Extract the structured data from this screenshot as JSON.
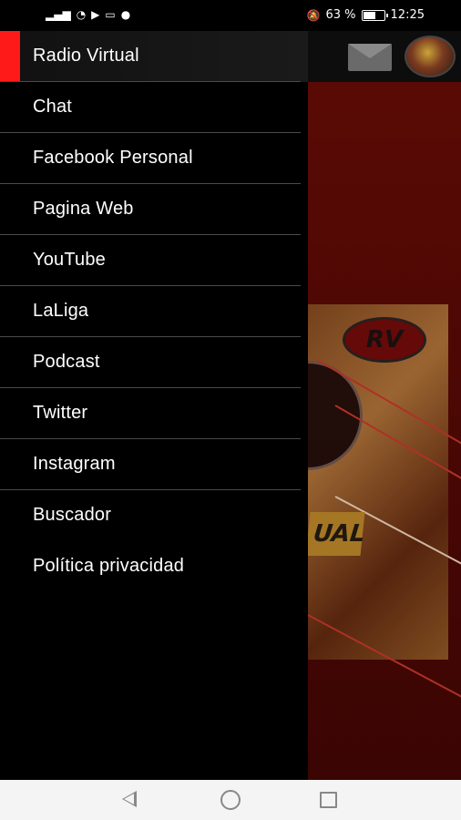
{
  "status_bar": {
    "battery_percent": "63 %",
    "time": "12:25",
    "left_icons": [
      "signal-icon",
      "wifi-icon",
      "play-icon",
      "cast-icon",
      "facebook-icon"
    ],
    "right_icons": [
      "mute-icon",
      "battery-icon"
    ],
    "battery_level": 0.63
  },
  "drawer": {
    "items": [
      {
        "label": "Radio Virtual",
        "active": true
      },
      {
        "label": "Chat"
      },
      {
        "label": "Facebook Personal"
      },
      {
        "label": "Pagina Web"
      },
      {
        "label": "YouTube"
      },
      {
        "label": "LaLiga"
      },
      {
        "label": "Podcast"
      },
      {
        "label": "Twitter"
      },
      {
        "label": "Instagram"
      },
      {
        "label": "Buscador"
      },
      {
        "label": "Política privacidad"
      }
    ],
    "accent_color": "#ff1a1a"
  },
  "background_app": {
    "logo_text": "RV",
    "banner_text": "UAL",
    "icons": [
      "mail-icon",
      "avatar"
    ]
  },
  "nav_bar": {
    "icons": [
      "back-icon",
      "home-icon",
      "recents-icon"
    ]
  }
}
